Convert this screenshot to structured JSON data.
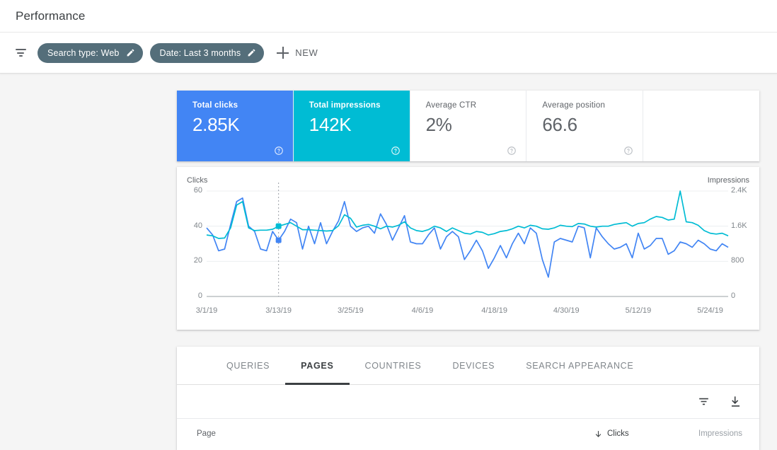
{
  "header": {
    "title": "Performance"
  },
  "filter_bar": {
    "filter_icon": "filter-icon",
    "chips": [
      {
        "label": "Search type: Web",
        "edit_icon": "pencil-icon"
      },
      {
        "label": "Date: Last 3 months",
        "edit_icon": "pencil-icon"
      }
    ],
    "new_button": {
      "label": "NEW",
      "icon": "plus-icon"
    }
  },
  "metrics": [
    {
      "label": "Total clicks",
      "value": "2.85K",
      "state": "selected",
      "color": "#4285f4",
      "help": "?"
    },
    {
      "label": "Total impressions",
      "value": "142K",
      "state": "selected",
      "color": "#00bcd4",
      "help": "?"
    },
    {
      "label": "Average CTR",
      "value": "2%",
      "state": "unselected",
      "color": "#ffffff",
      "help": "?"
    },
    {
      "label": "Average position",
      "value": "66.6",
      "state": "unselected",
      "color": "#ffffff",
      "help": "?"
    }
  ],
  "chart_data": {
    "type": "line",
    "title": "",
    "xlabel": "",
    "ylabel": "Clicks",
    "y2label": "Impressions",
    "grid": true,
    "legend": "none",
    "x_tick_labels": [
      "3/1/19",
      "3/13/19",
      "3/25/19",
      "4/6/19",
      "4/18/19",
      "4/30/19",
      "5/12/19",
      "5/24/19"
    ],
    "x_tick_indices": [
      0,
      12,
      24,
      36,
      48,
      60,
      72,
      84
    ],
    "y_left_ticks": [
      "0",
      "20",
      "40",
      "60"
    ],
    "y_right_ticks": [
      "0",
      "800",
      "1.6K",
      "2.4K"
    ],
    "ylim": [
      0,
      60
    ],
    "y2lim": [
      0,
      2400
    ],
    "hover_index": 12,
    "hover_clicks": 32,
    "hover_impressions": 1600,
    "series": [
      {
        "name": "Clicks",
        "color": "#4285f4",
        "axis": "left",
        "values": [
          39,
          35,
          26,
          27,
          41,
          54,
          56,
          40,
          37,
          27,
          26,
          37,
          32,
          37,
          44,
          42,
          27,
          40,
          30,
          42,
          30,
          37,
          43,
          54,
          40,
          37,
          39,
          40,
          36,
          47,
          41,
          32,
          39,
          46,
          31,
          30,
          30,
          35,
          39,
          27,
          34,
          37,
          34,
          21,
          26,
          32,
          26,
          16,
          22,
          29,
          22,
          30,
          36,
          30,
          39,
          36,
          21,
          11,
          31,
          33,
          32,
          31,
          40,
          39,
          22,
          39,
          34,
          30,
          27,
          28,
          30,
          22,
          36,
          27,
          29,
          33,
          33,
          24,
          26,
          31,
          30,
          28,
          32,
          30,
          27,
          26,
          30,
          28
        ]
      },
      {
        "name": "Impressions",
        "color": "#00bcd4",
        "axis": "right",
        "values": [
          1400,
          1380,
          1320,
          1330,
          1560,
          2080,
          2160,
          1560,
          1500,
          1510,
          1510,
          1530,
          1600,
          1640,
          1680,
          1600,
          1520,
          1520,
          1510,
          1500,
          1490,
          1500,
          1610,
          1860,
          1780,
          1580,
          1620,
          1640,
          1600,
          1540,
          1600,
          1580,
          1620,
          1700,
          1560,
          1500,
          1480,
          1520,
          1600,
          1560,
          1480,
          1560,
          1500,
          1440,
          1420,
          1480,
          1460,
          1400,
          1430,
          1480,
          1500,
          1540,
          1600,
          1560,
          1620,
          1600,
          1540,
          1530,
          1560,
          1620,
          1600,
          1590,
          1660,
          1650,
          1600,
          1580,
          1600,
          1600,
          1640,
          1660,
          1680,
          1600,
          1660,
          1680,
          1760,
          1820,
          1800,
          1740,
          1760,
          2400,
          1700,
          1680,
          1620,
          1500,
          1440,
          1420,
          1440,
          1380
        ]
      }
    ]
  },
  "table": {
    "tabs": [
      {
        "label": "QUERIES",
        "active": false
      },
      {
        "label": "PAGES",
        "active": true
      },
      {
        "label": "COUNTRIES",
        "active": false
      },
      {
        "label": "DEVICES",
        "active": false
      },
      {
        "label": "SEARCH APPEARANCE",
        "active": false
      }
    ],
    "toolbar": {
      "filter_icon": "filter-icon",
      "download_icon": "download-icon"
    },
    "columns": {
      "page": "Page",
      "clicks": "Clicks",
      "impressions": "Impressions",
      "sort_arrow": "arrow-down-icon"
    }
  }
}
